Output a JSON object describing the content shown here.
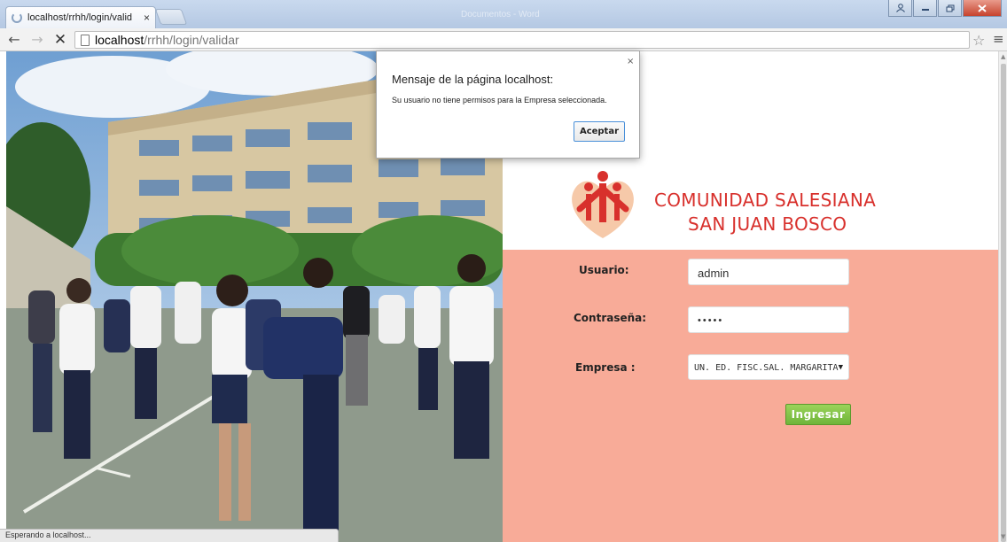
{
  "browser": {
    "tab_title": "localhost/rrhh/login/valid",
    "tab_close": "×",
    "window_title_ghost": "Documentos - Word",
    "url_host": "localhost",
    "url_path": "/rrhh/login/validar",
    "status_text": "Esperando a localhost..."
  },
  "brand": {
    "line1": "COMUNIDAD SALESIANA",
    "line2": "SAN JUAN BOSCO",
    "red": "#d8302c",
    "form_bg": "#f8ab98"
  },
  "form": {
    "usuario_label": "Usuario:",
    "usuario_value": "admin",
    "password_label": "Contraseña:",
    "password_value": "•••••",
    "empresa_label": "Empresa :",
    "empresa_value": "UN. ED. FISC.SAL. MARGARITA",
    "submit_label": "Ingresar"
  },
  "dialog": {
    "title": "Mensaje de la página localhost:",
    "message": "Su usuario no tiene permisos para la Empresa seleccionada.",
    "ok_label": "Aceptar",
    "close": "×"
  },
  "icons": [
    "back-icon",
    "forward-icon",
    "stop-icon",
    "page-icon",
    "star-icon",
    "menu-icon",
    "logo-icon"
  ]
}
